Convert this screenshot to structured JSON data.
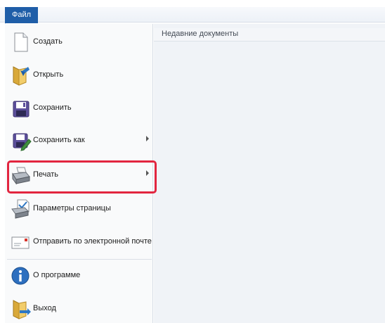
{
  "ribbon": {
    "file_tab": "Файл"
  },
  "menu": {
    "items": [
      {
        "label": "Создать",
        "icon": "new-document-icon",
        "submenu": false
      },
      {
        "label": "Открыть",
        "icon": "open-folder-icon",
        "submenu": false
      },
      {
        "label": "Сохранить",
        "icon": "save-disk-icon",
        "submenu": false
      },
      {
        "label": "Сохранить как",
        "icon": "save-as-icon",
        "submenu": true
      },
      {
        "label": "Печать",
        "icon": "printer-icon",
        "submenu": true,
        "highlighted": true
      },
      {
        "label": "Параметры страницы",
        "icon": "page-setup-icon",
        "submenu": false
      },
      {
        "label": "Отправить по электронной почте",
        "icon": "email-icon",
        "submenu": false
      },
      {
        "label": "О программе",
        "icon": "info-icon",
        "submenu": false
      },
      {
        "label": "Выход",
        "icon": "exit-icon",
        "submenu": false
      }
    ]
  },
  "recent": {
    "title": "Недавние документы"
  },
  "colors": {
    "file_tab": "#1f5ea8",
    "highlight": "#e2253f"
  }
}
